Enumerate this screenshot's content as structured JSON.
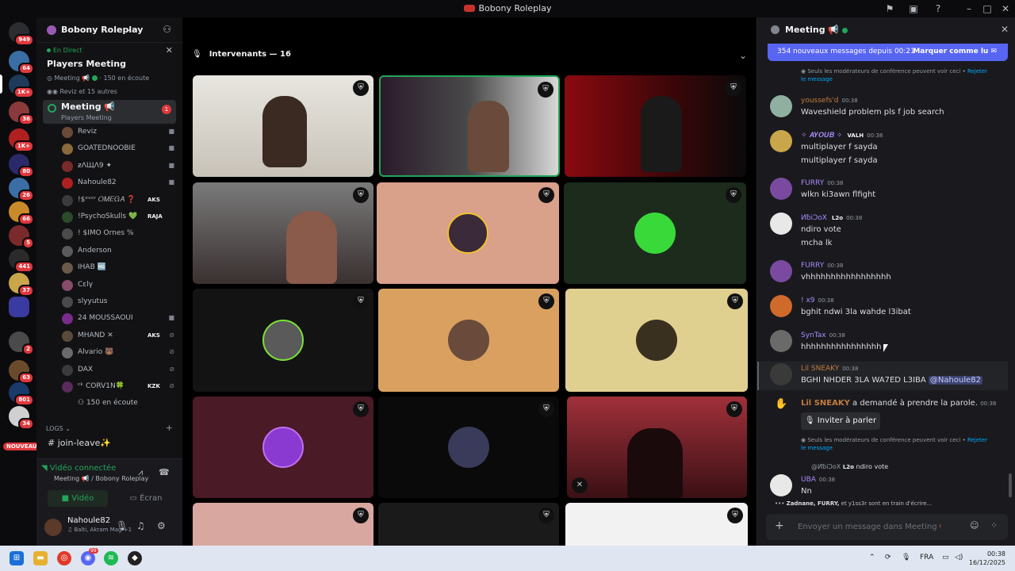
{
  "window": {
    "title": "Bobony Roleplay"
  },
  "guilds": {
    "badges": [
      "949",
      "64",
      "1K+",
      "36",
      "1K+",
      "80",
      "26",
      "66",
      "5",
      "441",
      "37",
      "10",
      "2",
      "63",
      "801",
      "34"
    ],
    "new_label": "NOUVEAU"
  },
  "sidebar": {
    "server_name": "Bobony Roleplay",
    "stage": {
      "live_label": "En Direct",
      "title": "Players Meeting",
      "meta_channel": "Meeting 📢",
      "meta_listeners": "150 en écoute",
      "meta_speakers": "Reviz et 15 autres"
    },
    "active_channel": {
      "name": "Meeting 📢",
      "subtitle": "Players Meeting",
      "badge": "1"
    },
    "members": [
      {
        "name": "Reviz",
        "tag": "",
        "color": "#6b4a3a"
      },
      {
        "name": "GOATEDNOOBIE",
        "tag": "",
        "color": "#8a6a3a"
      },
      {
        "name": "ƶΛЩΛ9 ✦",
        "tag": "",
        "color": "#7a2a2a"
      },
      {
        "name": "Nahoule82",
        "tag": "",
        "color": "#b02020"
      },
      {
        "name": "!$ᵉᵛᵒʳ 𝑂𝑀𝐸𝐺𝐴 ❓",
        "tag": "AKS",
        "color": "#3a3a3a"
      },
      {
        "name": "!PsychoSkulls 💚",
        "tag": "RAJA",
        "color": "#2a4a2a"
      },
      {
        "name": "! $IMO Ornes %",
        "tag": "",
        "color": "#4a4a4a"
      },
      {
        "name": "Anderson",
        "tag": "",
        "color": "#5a5a5a"
      },
      {
        "name": "IHAB 🆖",
        "tag": "",
        "color": "#6a5a4a"
      },
      {
        "name": "Cεlγ",
        "tag": "",
        "color": "#8a4a6a"
      },
      {
        "name": "slyyutus",
        "tag": "",
        "color": "#4a4a4a"
      },
      {
        "name": "24 MOUSSAOUI",
        "tag": "",
        "color": "#7a2a8a"
      },
      {
        "name": "MHAND ✕",
        "tag": "AKS",
        "color": "#5a4a3a"
      },
      {
        "name": "Alvario 🐻",
        "tag": "",
        "color": "#6a6a6a"
      },
      {
        "name": "DAX",
        "tag": "",
        "color": "#3a3a3a"
      },
      {
        "name": "ᶜᵏ CORV1N🍀",
        "tag": "KZK",
        "color": "#5a2a5a"
      }
    ],
    "listeners": "150 en écoute",
    "category": "LOGS",
    "join_channel": "join-leave✨"
  },
  "voice": {
    "status": "Vidéo connectée",
    "subtitle": "Meeting 📢 / Bobony Roleplay",
    "video_button": "Vidéo",
    "screen_button": "Écran"
  },
  "user": {
    "name": "Nahoule82",
    "subtitle": "♫ Balti, Akram Mag +1"
  },
  "stage_main": {
    "speakers_header": "Intervenants — 16"
  },
  "chat": {
    "title": "Meeting 📢",
    "new_messages": "354 nouveaux messages depuis 00:21",
    "mark_read": "Marquer comme lu",
    "moderator_note": "Seuls les modérateurs de conférence peuvent voir ceci",
    "reject_label": "Rejeter le message",
    "messages": [
      {
        "author": "youssefs'd",
        "author_color": "#c27c3e",
        "time": "00:38",
        "lines": [
          "Waveshield problem pls f job search"
        ],
        "avatar_color": "#8fb0a0"
      },
      {
        "author": "✧ 𝑨𝒀𝑶𝑼𝑩 ✧",
        "author_color": "#a78bfa",
        "time": "00:38",
        "tag": "VALH",
        "lines": [
          "multiplayer f sayda",
          "multiplayer f sayda"
        ],
        "avatar_color": "#c9a64a"
      },
      {
        "author": "FURRY",
        "author_color": "#a78bfa",
        "time": "00:38",
        "lines": [
          "wlkn ki3awn flfight"
        ],
        "avatar_color": "#7a4aa0"
      },
      {
        "author": "ИƀiϽoX",
        "author_color": "#a78bfa",
        "time": "00:38",
        "tag": "L2o",
        "lines": [
          "ndiro vote",
          "mcha lk"
        ],
        "avatar_color": "#e8e8e8"
      },
      {
        "author": "FURRY",
        "author_color": "#a78bfa",
        "time": "00:38",
        "lines": [
          "vhhhhhhhhhhhhhhhhh"
        ],
        "avatar_color": "#7a4aa0"
      },
      {
        "author": "! x9",
        "author_color": "#a78bfa",
        "time": "00:38",
        "lines": [
          "bghit ndwi 3la wahde l3ibat"
        ],
        "avatar_color": "#d06a2a"
      },
      {
        "author": "SynTax",
        "author_color": "#a78bfa",
        "time": "00:38",
        "lines": [
          "hhhhhhhhhhhhhhhh"
        ],
        "avatar_color": "#6a6a6a"
      },
      {
        "author": "Lil SNEAKY",
        "author_color": "#c27c3e",
        "time": "00:38",
        "lines": [
          "BGHI NHDER 3LA WA7ED L3IBA"
        ],
        "mention": "@Nahoule82",
        "avatar_color": "#3a3a3a"
      }
    ],
    "hand_raise_user": "Lil SNEAKY",
    "hand_raise_text": "a demandé à prendre la parole.",
    "hand_raise_time": "00:38",
    "invite_button": "Inviter à parler",
    "reply_ref": {
      "author": "@ИƀiϽoX",
      "tag": "L2o",
      "text": "ndiro vote"
    },
    "last_message": {
      "author": "UBA",
      "time": "00:38",
      "text": "Nn"
    },
    "typing": {
      "names": "Zadnane, FURRY,",
      "rest": "et y1ss3r sont en train d'écrire..."
    },
    "composer_placeholder": "Envoyer un message dans Meeting 📢"
  },
  "taskbar": {
    "lang": "FRA",
    "time": "00:38",
    "date": "16/12/2025",
    "discord_badge": "99"
  },
  "colors": {
    "accent": "#5865f2",
    "online": "#23a55a",
    "danger": "#e0383e"
  }
}
